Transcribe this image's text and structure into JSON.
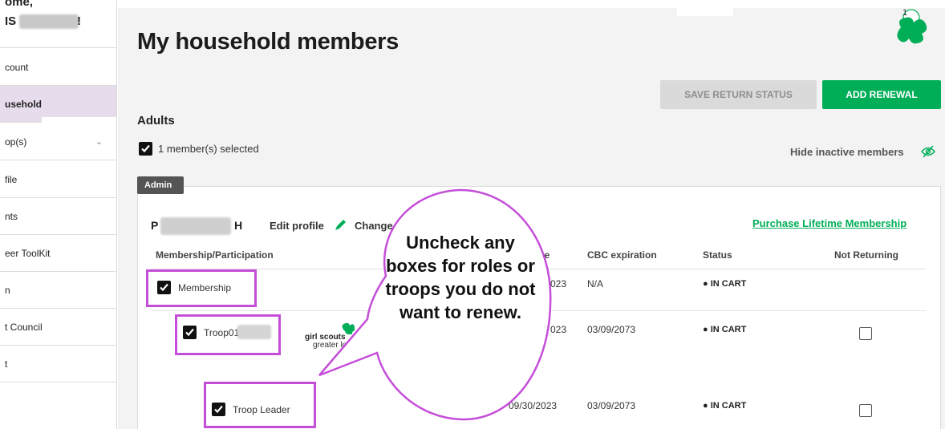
{
  "sidebar": {
    "header_line1": "ome,",
    "header_line2": "IS",
    "header_line2_end": "!",
    "items": [
      {
        "label": "count"
      },
      {
        "label": "usehold"
      },
      {
        "label": "op(s)"
      },
      {
        "label": "file"
      },
      {
        "label": "nts"
      },
      {
        "label": "eer ToolKit"
      },
      {
        "label": "n"
      },
      {
        "label": "t Council"
      },
      {
        "label": "t"
      }
    ]
  },
  "header": {
    "title": "My household members",
    "cart_count": "1"
  },
  "actions": {
    "save_label": "SAVE RETURN STATUS",
    "add_label": "ADD RENEWAL"
  },
  "adults": {
    "heading": "Adults",
    "selected_text": "1 member(s) selected",
    "hide_inactive": "Hide inactive members"
  },
  "member": {
    "badge": "Admin",
    "name_start": "P",
    "name_end": "H",
    "edit_profile": "Edit profile",
    "change_text": "Change r",
    "purchase_link": "Purchase Lifetime Membership",
    "columns": {
      "participation": "Membership/Participation",
      "date_fragment": "ate",
      "cbc": "CBC expiration",
      "status": "Status",
      "not_returning": "Not Returning"
    },
    "rows": [
      {
        "label": "Membership",
        "date": "023",
        "cbc": "N/A",
        "status": "● IN CART"
      },
      {
        "label": "Troop01",
        "date": "023",
        "cbc": "03/09/2073",
        "status": "● IN CART"
      },
      {
        "label": "Troop Leader",
        "date": "09/30/2023",
        "cbc": "03/09/2073",
        "status": "● IN CART"
      }
    ],
    "logo_line1": "girl scouts",
    "logo_line2": "greater los ange"
  },
  "callout": {
    "text": "Uncheck any boxes for roles or troops you do not want to renew."
  },
  "colors": {
    "accent_green": "#00ae58",
    "callout_purple": "#c44ed8",
    "active_nav": "#e7dcec"
  }
}
